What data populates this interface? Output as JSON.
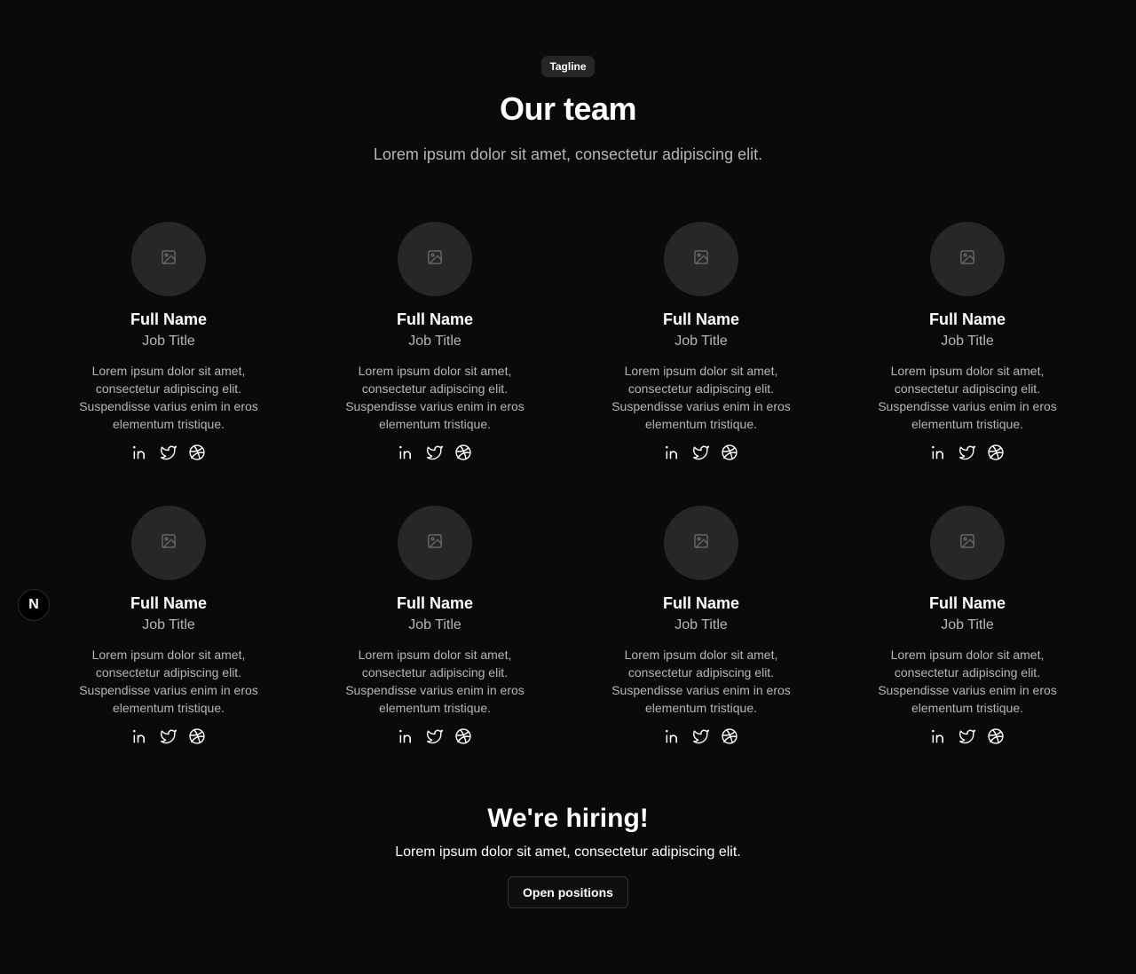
{
  "header": {
    "tagline": "Tagline",
    "title": "Our team",
    "subtitle": "Lorem ipsum dolor sit amet, consectetur adipiscing elit."
  },
  "team": [
    {
      "name": "Full Name",
      "job_title": "Job Title",
      "bio": "Lorem ipsum dolor sit amet, consectetur adipiscing elit. Suspendisse varius enim in eros elementum tristique."
    },
    {
      "name": "Full Name",
      "job_title": "Job Title",
      "bio": "Lorem ipsum dolor sit amet, consectetur adipiscing elit. Suspendisse varius enim in eros elementum tristique."
    },
    {
      "name": "Full Name",
      "job_title": "Job Title",
      "bio": "Lorem ipsum dolor sit amet, consectetur adipiscing elit. Suspendisse varius enim in eros elementum tristique."
    },
    {
      "name": "Full Name",
      "job_title": "Job Title",
      "bio": "Lorem ipsum dolor sit amet, consectetur adipiscing elit. Suspendisse varius enim in eros elementum tristique."
    },
    {
      "name": "Full Name",
      "job_title": "Job Title",
      "bio": "Lorem ipsum dolor sit amet, consectetur adipiscing elit. Suspendisse varius enim in eros elementum tristique."
    },
    {
      "name": "Full Name",
      "job_title": "Job Title",
      "bio": "Lorem ipsum dolor sit amet, consectetur adipiscing elit. Suspendisse varius enim in eros elementum tristique."
    },
    {
      "name": "Full Name",
      "job_title": "Job Title",
      "bio": "Lorem ipsum dolor sit amet, consectetur adipiscing elit. Suspendisse varius enim in eros elementum tristique."
    },
    {
      "name": "Full Name",
      "job_title": "Job Title",
      "bio": "Lorem ipsum dolor sit amet, consectetur adipiscing elit. Suspendisse varius enim in eros elementum tristique."
    }
  ],
  "social_icons": [
    "linkedin-icon",
    "twitter-icon",
    "dribbble-icon"
  ],
  "hiring": {
    "title": "We're hiring!",
    "text": "Lorem ipsum dolor sit amet, consectetur adipiscing elit.",
    "button_label": "Open positions"
  },
  "dev_badge": {
    "letter": "N"
  },
  "colors": {
    "background": "#0a0a0a",
    "avatar": "#272727",
    "muted_text": "#b5b5b5",
    "tag_bg": "#262626"
  }
}
